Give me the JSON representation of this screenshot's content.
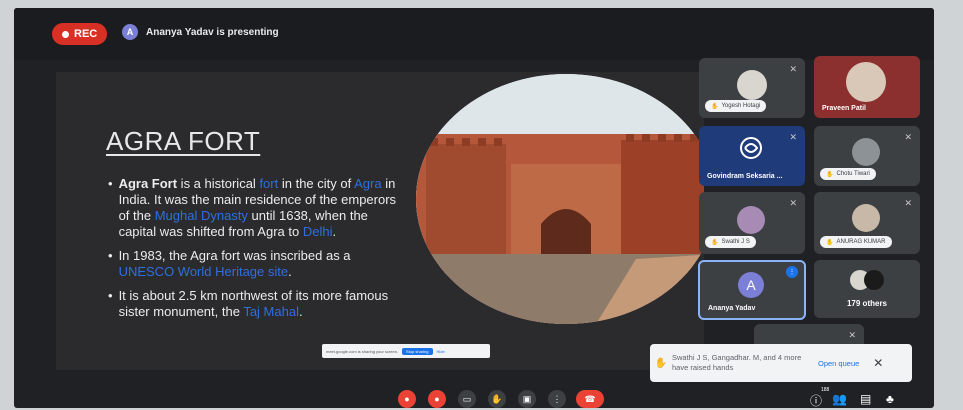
{
  "topbar": {
    "rec_label": "REC",
    "presenter_initial": "A",
    "presenter_text": "Ananya Yadav is presenting"
  },
  "slide": {
    "title": "AGRA FORT",
    "bullet1": {
      "p1": "Agra Fort",
      "p2": " is a historical ",
      "l1": "fort",
      "p3": " in the city of ",
      "l2": "Agra",
      "p4": " in India. It was the main residence of the emperors of the ",
      "l3": "Mughal Dynasty",
      "p5": " until 1638, when the capital was shifted from Agra to ",
      "l4": "Delhi",
      "p6": "."
    },
    "bullet2": {
      "p1": "In 1983, the Agra fort was inscribed as a ",
      "l1": "UNESCO World Heritage site",
      "p2": "."
    },
    "bullet3": {
      "p1": "It is about 2.5 km northwest of its more famous sister monument, the ",
      "l1": "Taj Mahal",
      "p2": "."
    }
  },
  "sharebar": {
    "text": "meet.google.com is sharing your screen.",
    "stop_label": "Stop sharing",
    "hide_label": "Hide"
  },
  "participants": {
    "yogesh": "Yogesh Hotagi",
    "praveen": "Praveen Patil",
    "govindram": "Govindram Seksaria ...",
    "chotu": "Chotu Tiwari",
    "swathi": "Swathi J S",
    "anurag": "ANURAG KUMAR",
    "ananya": "Ananya Yadav",
    "ananya_initial": "A",
    "others": "179 others"
  },
  "toast": {
    "text": "Swathi J S, Gangadhar. M, and 4 more have raised hands",
    "open_label": "Open queue",
    "close_glyph": "✕"
  },
  "bottombar": {
    "participant_count": "188"
  },
  "colors": {
    "rec_red": "#d93025",
    "link_blue": "#2f6fe0",
    "accent_blue": "#1a73e8",
    "active_tile_border": "#8ab4f8"
  }
}
